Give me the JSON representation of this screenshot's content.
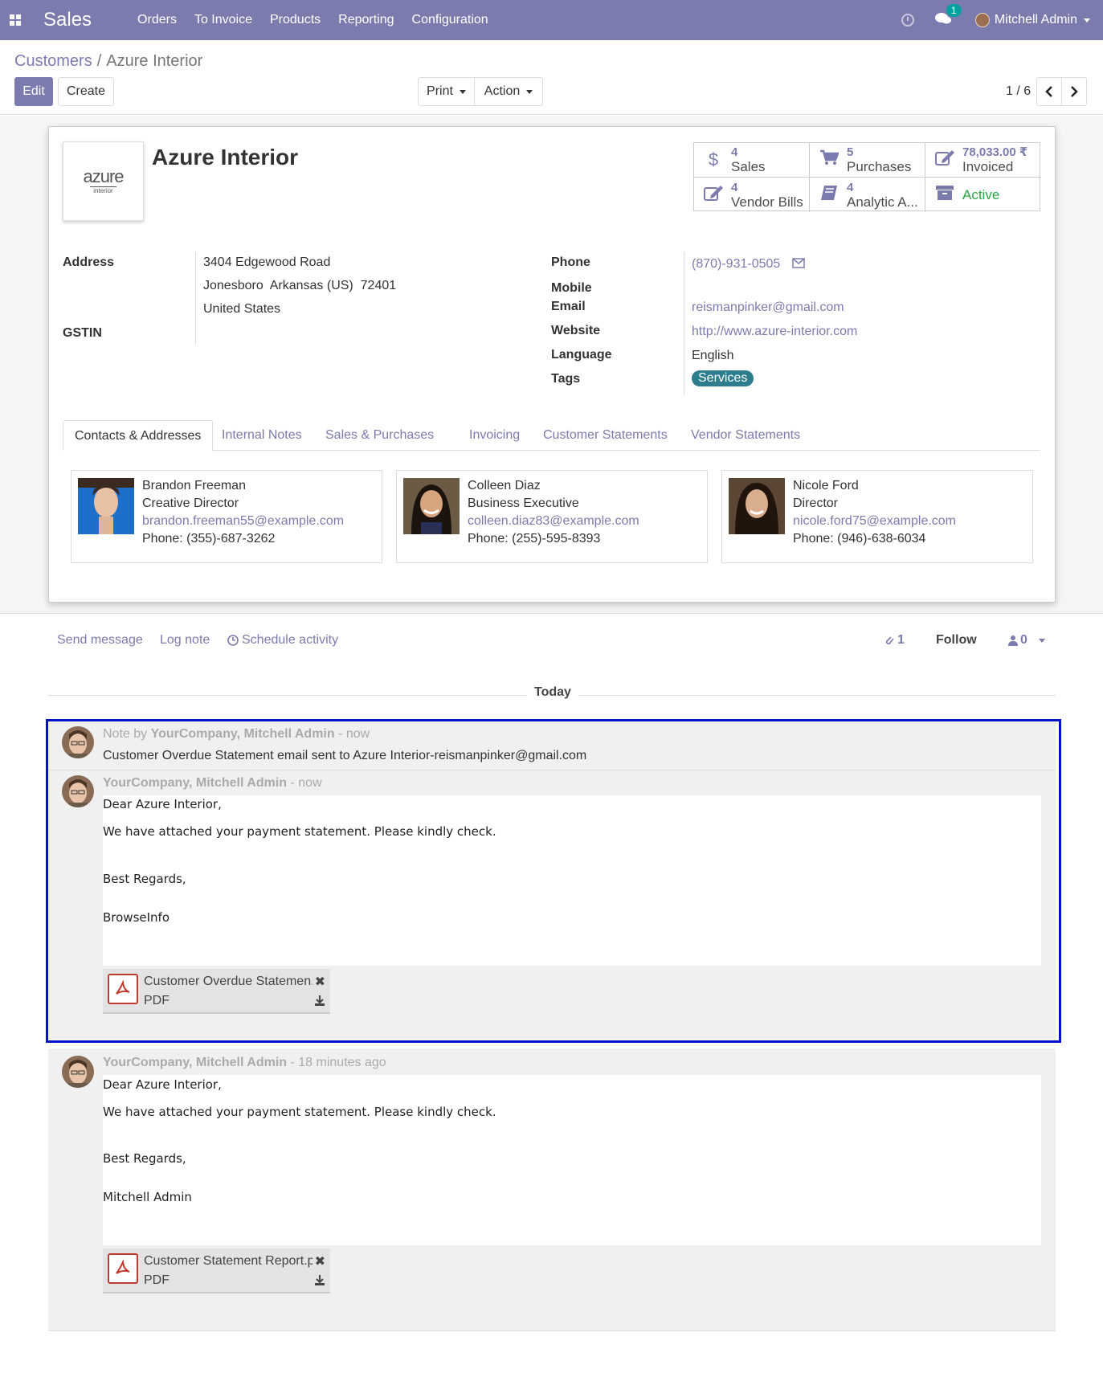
{
  "navbar": {
    "app": "Sales",
    "menu": [
      "Orders",
      "To Invoice",
      "Products",
      "Reporting",
      "Configuration"
    ],
    "chat_count": "1",
    "user": "Mitchell Admin"
  },
  "breadcrumb": {
    "parent": "Customers",
    "sep": "/",
    "current": "Azure Interior"
  },
  "buttons": {
    "edit": "Edit",
    "create": "Create",
    "print": "Print",
    "action": "Action"
  },
  "pager": "1 / 6",
  "record": {
    "logo_word": "azure",
    "logo_sub": "interior",
    "name": "Azure Interior",
    "stats": [
      {
        "icon": "dollar-icon",
        "glyph": "$",
        "num": "4",
        "label": "Sales"
      },
      {
        "icon": "cart-icon",
        "glyph": "🛒",
        "num": "5",
        "label": "Purchases"
      },
      {
        "icon": "edit-icon",
        "glyph": "✎",
        "num": "78,033.00 ₹",
        "label": "Invoiced"
      },
      {
        "icon": "edit-icon",
        "glyph": "✎",
        "num": "4",
        "label": "Vendor Bills"
      },
      {
        "icon": "book-icon",
        "glyph": "📘",
        "num": "4",
        "label": "Analytic A..."
      },
      {
        "icon": "archive-icon",
        "glyph": "▬",
        "num": "",
        "label": "Active"
      }
    ],
    "labels": {
      "address": "Address",
      "gstin": "GSTIN",
      "phone": "Phone",
      "mobile": "Mobile",
      "email": "Email",
      "website": "Website",
      "language": "Language",
      "tags": "Tags"
    },
    "address": [
      "3404 Edgewood Road",
      "Jonesboro  Arkansas (US)  72401",
      "United States"
    ],
    "phone": "(870)-931-0505",
    "email": "reismanpinker@gmail.com",
    "website": "http://www.azure-interior.com",
    "language": "English",
    "tag": "Services"
  },
  "tabs": [
    "Contacts & Addresses",
    "Internal Notes",
    "Sales & Purchases",
    "Invoicing",
    "Customer Statements",
    "Vendor Statements"
  ],
  "contacts": [
    {
      "name": "Brandon Freeman",
      "title": "Creative Director",
      "email": "brandon.freeman55@example.com",
      "phone": "Phone: (355)-687-3262"
    },
    {
      "name": "Colleen Diaz",
      "title": "Business Executive",
      "email": "colleen.diaz83@example.com",
      "phone": "Phone: (255)-595-8393"
    },
    {
      "name": "Nicole Ford",
      "title": "Director",
      "email": "nicole.ford75@example.com",
      "phone": "Phone: (946)-638-6034"
    }
  ],
  "chatter": {
    "send_message": "Send message",
    "log_note": "Log note",
    "schedule_activity": "Schedule activity",
    "attachments": "1",
    "follow": "Follow",
    "followers": "0",
    "today": "Today"
  },
  "messages": [
    {
      "prefix": "Note by ",
      "author": "YourCompany, Mitchell Admin",
      "when": " - now",
      "text": "Customer Overdue Statement email sent to Azure Interior-reismanpinker@gmail.com"
    },
    {
      "author": "YourCompany, Mitchell Admin",
      "when": " - now",
      "lines": [
        "Dear Azure Interior,",
        "We have attached your payment statement. Please kindly check.",
        "Best Regards,",
        "BrowseInfo"
      ],
      "attachment": {
        "name": "Customer Overdue Statemen...",
        "type": "PDF"
      }
    },
    {
      "author": "YourCompany, Mitchell Admin",
      "when": " - 18 minutes ago",
      "lines": [
        "Dear Azure Interior,",
        "We have attached your payment statement. Please kindly check.",
        "Best Regards,",
        "Mitchell Admin"
      ],
      "attachment": {
        "name": "Customer Statement Report.pdf",
        "type": "PDF"
      }
    }
  ]
}
